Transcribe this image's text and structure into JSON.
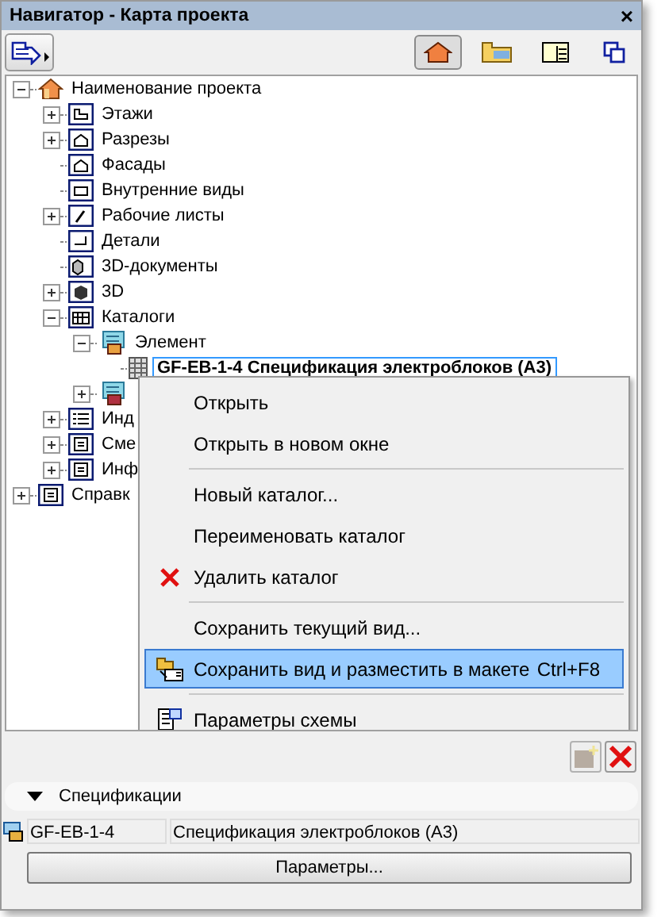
{
  "window": {
    "title": "Навигатор - Карта проекта",
    "close": "×"
  },
  "toolbar": {
    "left_button": {
      "kind": "publish"
    },
    "view_buttons": [
      {
        "kind": "project",
        "selected": true
      },
      {
        "kind": "views",
        "selected": false
      },
      {
        "kind": "layouts",
        "selected": false
      },
      {
        "kind": "sets",
        "selected": false
      }
    ]
  },
  "tree": [
    {
      "label": "Наименование проекта",
      "kind": "project",
      "expanded": true,
      "selected": false,
      "children": [
        {
          "label": "Этажи",
          "kind": "plan",
          "expanded": false,
          "selected": false
        },
        {
          "label": "Разрезы",
          "kind": "section",
          "expanded": false,
          "selected": false
        },
        {
          "label": "Фасады",
          "kind": "section",
          "selected": false
        },
        {
          "label": "Внутренние виды",
          "kind": "interior",
          "selected": false
        },
        {
          "label": "Рабочие листы",
          "kind": "worksheet",
          "expanded": false,
          "selected": false
        },
        {
          "label": "Детали",
          "kind": "detail",
          "selected": false
        },
        {
          "label": "3D-документы",
          "kind": "doc3d",
          "selected": false
        },
        {
          "label": "3D",
          "kind": "cube",
          "expanded": false,
          "selected": false
        },
        {
          "label": "Каталоги",
          "kind": "table",
          "expanded": true,
          "selected": false,
          "children": [
            {
              "label": "Элемент",
              "kind": "catalog",
              "expanded": true,
              "selected": false,
              "children": [
                {
                  "label": "GF-EB-1-4 Спецификация электроблоков (А3)",
                  "kind": "grid",
                  "selected": true
                }
              ]
            },
            {
              "kind": "catalog2",
              "expanded": false
            }
          ]
        },
        {
          "label": "Инд",
          "kind": "list",
          "expanded": false,
          "selected": false
        },
        {
          "label": "Сме",
          "kind": "info",
          "expanded": false,
          "selected": false
        },
        {
          "label": "Инф",
          "kind": "info",
          "expanded": false,
          "selected": false
        }
      ]
    },
    {
      "label": "Справк",
      "kind": "info",
      "expanded": false,
      "selected": false
    }
  ],
  "context_menu": [
    {
      "kind": "item",
      "label": "Открыть",
      "selected": false
    },
    {
      "kind": "item",
      "label": "Открыть в новом окне",
      "selected": false
    },
    {
      "kind": "separator"
    },
    {
      "kind": "item",
      "label": "Новый каталог...",
      "selected": false
    },
    {
      "kind": "item",
      "label": "Переименовать каталог",
      "selected": false
    },
    {
      "kind": "delete",
      "label": "Удалить каталог",
      "selected": false
    },
    {
      "kind": "separator"
    },
    {
      "kind": "item",
      "label": "Сохранить текущий вид...",
      "selected": false
    },
    {
      "kind": "place",
      "label": "Сохранить вид и разместить в макете",
      "shortcut": "Ctrl+F8",
      "selected": true
    },
    {
      "kind": "separator"
    },
    {
      "kind": "scheme",
      "label": "Параметры схемы",
      "selected": false
    }
  ],
  "panel_buttons": [
    {
      "kind": "new",
      "disabled": true
    },
    {
      "kind": "delete",
      "disabled": false
    }
  ],
  "properties": {
    "title": "Спецификации",
    "expanded": true,
    "id": "GF-EB-1-4",
    "name": "Спецификация электроблоков (А3)",
    "button": "Параметры..."
  }
}
